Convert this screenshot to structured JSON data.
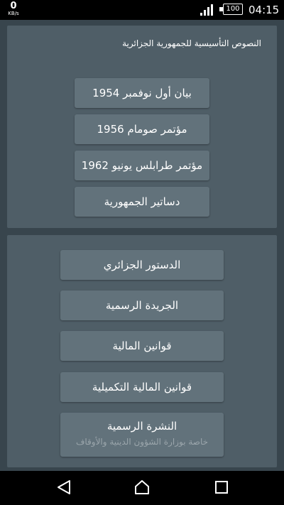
{
  "status_bar": {
    "speed_value": "0",
    "speed_unit": "KB/s",
    "battery": "100",
    "time": "04:15"
  },
  "top_panel": {
    "title": "النصوص التأسيسية للجمهورية الجزائرية",
    "buttons": [
      {
        "label": "بيان أول نوفمبر 1954"
      },
      {
        "label": "مؤتمر صومام 1956"
      },
      {
        "label": "مؤتمر طرابلس يونيو 1962"
      },
      {
        "label": "دساتير الجمهورية"
      }
    ]
  },
  "bottom_panel": {
    "buttons": [
      {
        "label": "الدستور الجزائري"
      },
      {
        "label": "الجريدة الرسمية"
      },
      {
        "label": "قوانين المالية"
      },
      {
        "label": "قوانين المالية التكميلية"
      },
      {
        "label": "النشرة الرسمية",
        "subtitle": "خاصة بوزارة الشؤون الدينية والأوقاف"
      }
    ]
  },
  "nav_bar": {
    "icons": [
      "back-icon",
      "home-icon",
      "recents-icon"
    ]
  },
  "colors": {
    "background": "#38454d",
    "panel": "#4f5e67",
    "button": "#62727b",
    "text": "#ffffff",
    "subtitle": "#9aa5ab"
  }
}
